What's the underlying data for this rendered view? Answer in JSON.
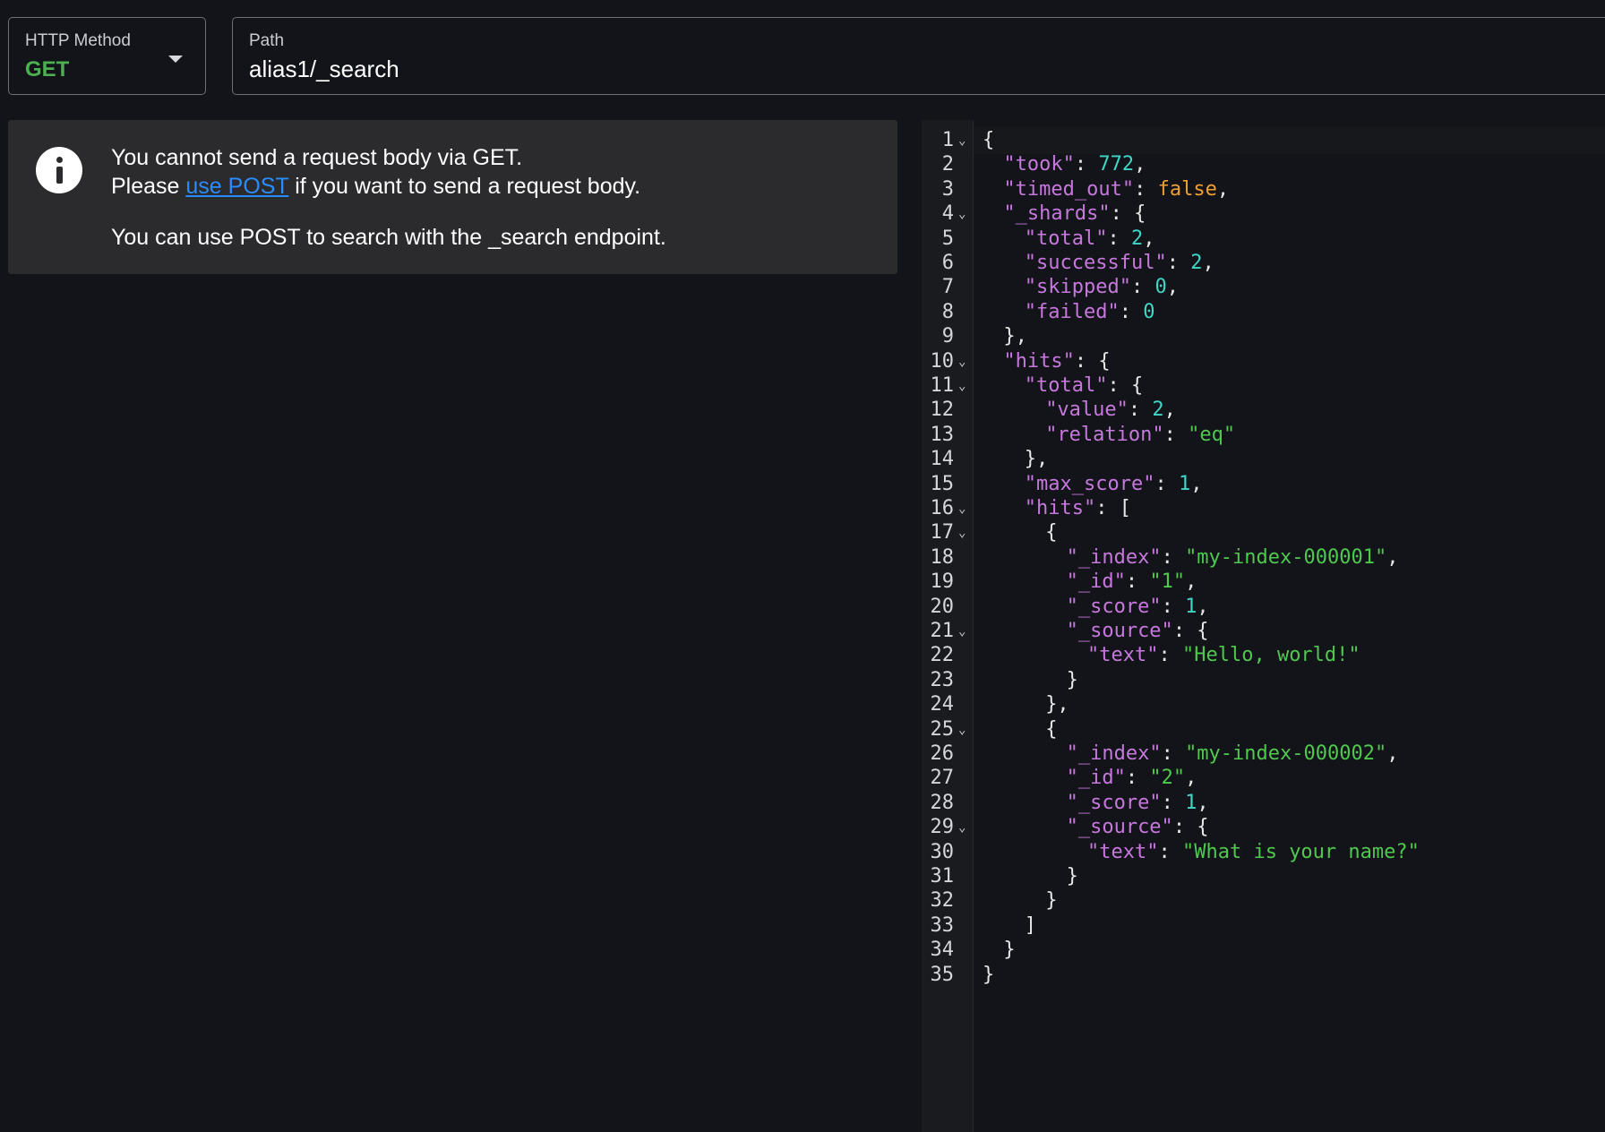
{
  "request": {
    "method_label": "HTTP Method",
    "method_value": "GET",
    "path_label": "Path",
    "path_value": "alias1/_search"
  },
  "alert": {
    "line1": "You cannot send a request body via GET.",
    "line2_prefix": "Please ",
    "line2_link": "use POST",
    "line2_suffix": " if you want to send a request body.",
    "line3": "You can use POST to search with the _search endpoint."
  },
  "colors": {
    "key": "#c678dd",
    "string": "#4ec94e",
    "number": "#3fd6c6",
    "boolean": "#f0a030",
    "method_get": "#4caf50",
    "link": "#2b8cff"
  },
  "response": {
    "lines": [
      {
        "n": "1",
        "fold": true,
        "indent": 0,
        "tokens": [
          [
            "p",
            "{"
          ]
        ]
      },
      {
        "n": "2",
        "fold": false,
        "indent": 1,
        "tokens": [
          [
            "k",
            "\"took\""
          ],
          [
            "p",
            ": "
          ],
          [
            "n",
            "772"
          ],
          [
            "p",
            ","
          ]
        ]
      },
      {
        "n": "3",
        "fold": false,
        "indent": 1,
        "tokens": [
          [
            "k",
            "\"timed_out\""
          ],
          [
            "p",
            ": "
          ],
          [
            "b",
            "false"
          ],
          [
            "p",
            ","
          ]
        ]
      },
      {
        "n": "4",
        "fold": true,
        "indent": 1,
        "tokens": [
          [
            "k",
            "\"_shards\""
          ],
          [
            "p",
            ": {"
          ]
        ]
      },
      {
        "n": "5",
        "fold": false,
        "indent": 2,
        "tokens": [
          [
            "k",
            "\"total\""
          ],
          [
            "p",
            ": "
          ],
          [
            "n",
            "2"
          ],
          [
            "p",
            ","
          ]
        ]
      },
      {
        "n": "6",
        "fold": false,
        "indent": 2,
        "tokens": [
          [
            "k",
            "\"successful\""
          ],
          [
            "p",
            ": "
          ],
          [
            "n",
            "2"
          ],
          [
            "p",
            ","
          ]
        ]
      },
      {
        "n": "7",
        "fold": false,
        "indent": 2,
        "tokens": [
          [
            "k",
            "\"skipped\""
          ],
          [
            "p",
            ": "
          ],
          [
            "n",
            "0"
          ],
          [
            "p",
            ","
          ]
        ]
      },
      {
        "n": "8",
        "fold": false,
        "indent": 2,
        "tokens": [
          [
            "k",
            "\"failed\""
          ],
          [
            "p",
            ": "
          ],
          [
            "n",
            "0"
          ]
        ]
      },
      {
        "n": "9",
        "fold": false,
        "indent": 1,
        "tokens": [
          [
            "p",
            "},"
          ]
        ]
      },
      {
        "n": "10",
        "fold": true,
        "indent": 1,
        "tokens": [
          [
            "k",
            "\"hits\""
          ],
          [
            "p",
            ": {"
          ]
        ]
      },
      {
        "n": "11",
        "fold": true,
        "indent": 2,
        "tokens": [
          [
            "k",
            "\"total\""
          ],
          [
            "p",
            ": {"
          ]
        ]
      },
      {
        "n": "12",
        "fold": false,
        "indent": 3,
        "tokens": [
          [
            "k",
            "\"value\""
          ],
          [
            "p",
            ": "
          ],
          [
            "n",
            "2"
          ],
          [
            "p",
            ","
          ]
        ]
      },
      {
        "n": "13",
        "fold": false,
        "indent": 3,
        "tokens": [
          [
            "k",
            "\"relation\""
          ],
          [
            "p",
            ": "
          ],
          [
            "s",
            "\"eq\""
          ]
        ]
      },
      {
        "n": "14",
        "fold": false,
        "indent": 2,
        "tokens": [
          [
            "p",
            "},"
          ]
        ]
      },
      {
        "n": "15",
        "fold": false,
        "indent": 2,
        "tokens": [
          [
            "k",
            "\"max_score\""
          ],
          [
            "p",
            ": "
          ],
          [
            "n",
            "1"
          ],
          [
            "p",
            ","
          ]
        ]
      },
      {
        "n": "16",
        "fold": true,
        "indent": 2,
        "tokens": [
          [
            "k",
            "\"hits\""
          ],
          [
            "p",
            ": ["
          ]
        ]
      },
      {
        "n": "17",
        "fold": true,
        "indent": 3,
        "tokens": [
          [
            "p",
            "{"
          ]
        ]
      },
      {
        "n": "18",
        "fold": false,
        "indent": 4,
        "tokens": [
          [
            "k",
            "\"_index\""
          ],
          [
            "p",
            ": "
          ],
          [
            "s",
            "\"my-index-000001\""
          ],
          [
            "p",
            ","
          ]
        ]
      },
      {
        "n": "19",
        "fold": false,
        "indent": 4,
        "tokens": [
          [
            "k",
            "\"_id\""
          ],
          [
            "p",
            ": "
          ],
          [
            "s",
            "\"1\""
          ],
          [
            "p",
            ","
          ]
        ]
      },
      {
        "n": "20",
        "fold": false,
        "indent": 4,
        "tokens": [
          [
            "k",
            "\"_score\""
          ],
          [
            "p",
            ": "
          ],
          [
            "n",
            "1"
          ],
          [
            "p",
            ","
          ]
        ]
      },
      {
        "n": "21",
        "fold": true,
        "indent": 4,
        "tokens": [
          [
            "k",
            "\"_source\""
          ],
          [
            "p",
            ": {"
          ]
        ]
      },
      {
        "n": "22",
        "fold": false,
        "indent": 5,
        "tokens": [
          [
            "k",
            "\"text\""
          ],
          [
            "p",
            ": "
          ],
          [
            "s",
            "\"Hello, world!\""
          ]
        ]
      },
      {
        "n": "23",
        "fold": false,
        "indent": 4,
        "tokens": [
          [
            "p",
            "}"
          ]
        ]
      },
      {
        "n": "24",
        "fold": false,
        "indent": 3,
        "tokens": [
          [
            "p",
            "},"
          ]
        ]
      },
      {
        "n": "25",
        "fold": true,
        "indent": 3,
        "tokens": [
          [
            "p",
            "{"
          ]
        ]
      },
      {
        "n": "26",
        "fold": false,
        "indent": 4,
        "tokens": [
          [
            "k",
            "\"_index\""
          ],
          [
            "p",
            ": "
          ],
          [
            "s",
            "\"my-index-000002\""
          ],
          [
            "p",
            ","
          ]
        ]
      },
      {
        "n": "27",
        "fold": false,
        "indent": 4,
        "tokens": [
          [
            "k",
            "\"_id\""
          ],
          [
            "p",
            ": "
          ],
          [
            "s",
            "\"2\""
          ],
          [
            "p",
            ","
          ]
        ]
      },
      {
        "n": "28",
        "fold": false,
        "indent": 4,
        "tokens": [
          [
            "k",
            "\"_score\""
          ],
          [
            "p",
            ": "
          ],
          [
            "n",
            "1"
          ],
          [
            "p",
            ","
          ]
        ]
      },
      {
        "n": "29",
        "fold": true,
        "indent": 4,
        "tokens": [
          [
            "k",
            "\"_source\""
          ],
          [
            "p",
            ": {"
          ]
        ]
      },
      {
        "n": "30",
        "fold": false,
        "indent": 5,
        "tokens": [
          [
            "k",
            "\"text\""
          ],
          [
            "p",
            ": "
          ],
          [
            "s",
            "\"What is your name?\""
          ]
        ]
      },
      {
        "n": "31",
        "fold": false,
        "indent": 4,
        "tokens": [
          [
            "p",
            "}"
          ]
        ]
      },
      {
        "n": "32",
        "fold": false,
        "indent": 3,
        "tokens": [
          [
            "p",
            "}"
          ]
        ]
      },
      {
        "n": "33",
        "fold": false,
        "indent": 2,
        "tokens": [
          [
            "p",
            "]"
          ]
        ]
      },
      {
        "n": "34",
        "fold": false,
        "indent": 1,
        "tokens": [
          [
            "p",
            "}"
          ]
        ]
      },
      {
        "n": "35",
        "fold": false,
        "indent": 0,
        "tokens": [
          [
            "p",
            "}"
          ]
        ]
      }
    ]
  }
}
